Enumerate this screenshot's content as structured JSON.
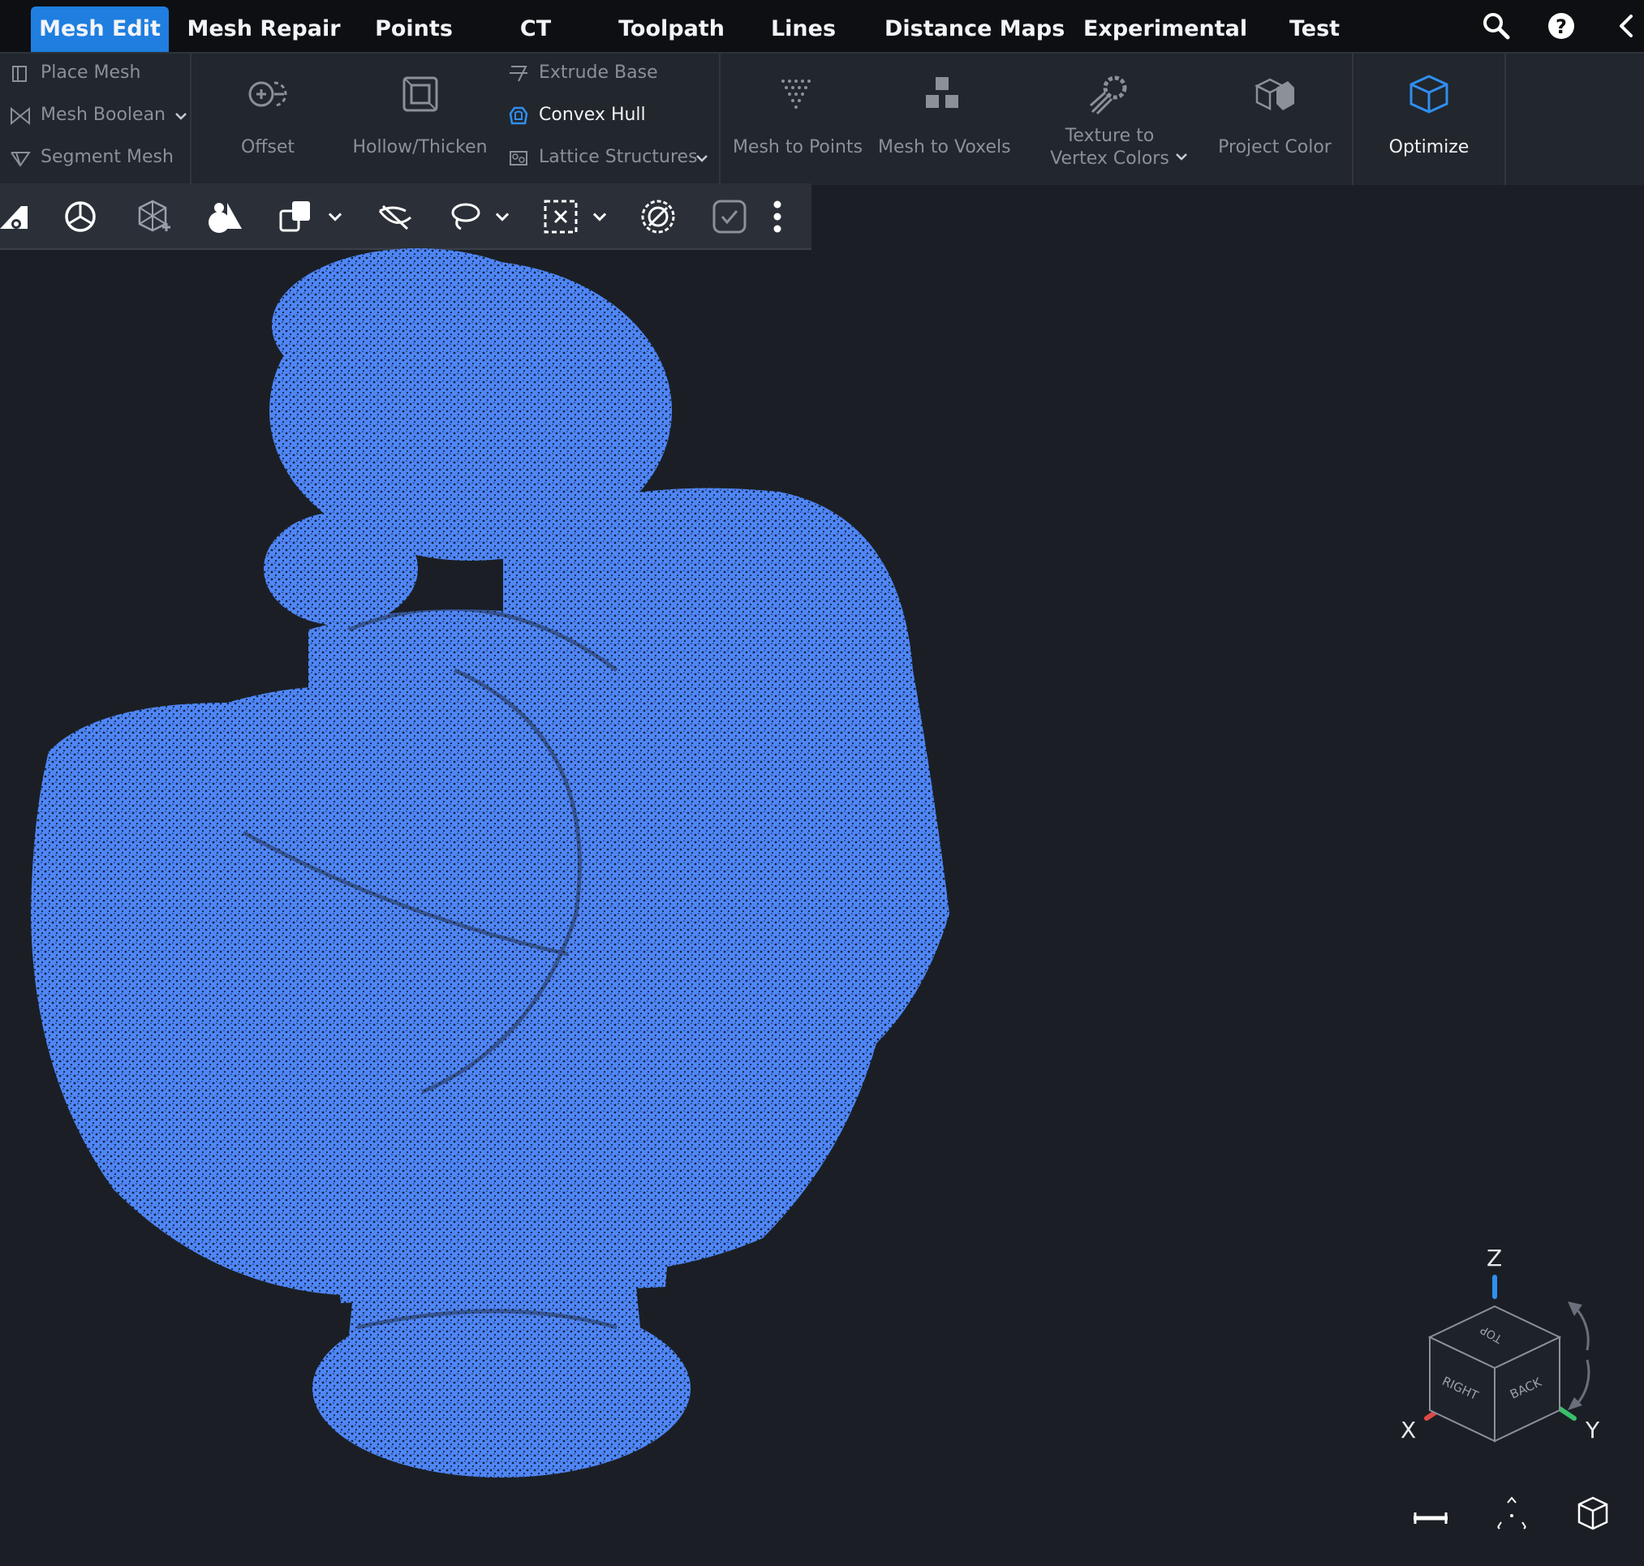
{
  "tabs": [
    {
      "label": "Mesh Edit",
      "active": true
    },
    {
      "label": "Mesh Repair"
    },
    {
      "label": "Points"
    },
    {
      "label": "CT"
    },
    {
      "label": "Toolpath"
    },
    {
      "label": "Lines"
    },
    {
      "label": "Distance Maps"
    },
    {
      "label": "Experimental"
    },
    {
      "label": "Test"
    }
  ],
  "top_icons": [
    "search-icon",
    "help-icon",
    "collapse-left-icon"
  ],
  "ribbon": {
    "left_group": [
      "Place Mesh",
      "Mesh Boolean",
      "Segment Mesh"
    ],
    "offset": "Offset",
    "hollow": "Hollow/Thicken",
    "right_small_group": [
      "Extrude Base",
      "Convex Hull",
      "Lattice Structures"
    ],
    "mesh_to_points": "Mesh to Points",
    "mesh_to_voxels": "Mesh to Voxels",
    "texture_line1": "Texture to",
    "texture_line2": "Vertex Colors",
    "project_color": "Project Color",
    "optimize": "Optimize"
  },
  "toolbar_icons": [
    "edit-settings-icon",
    "orbit-icon",
    "transform-icon",
    "shapes-icon",
    "copy-icon",
    "hide-icon",
    "lasso-icon",
    "box-select-icon",
    "deselect-icon",
    "check-icon",
    "more-icon"
  ],
  "nav_cube": {
    "z": "Z",
    "x": "X",
    "y": "Y",
    "top": "TOP",
    "right": "RIGHT",
    "back": "BACK"
  },
  "colors": {
    "accent": "#1f7ee0",
    "points": "#4f86f7",
    "axis_x": "#e04848",
    "axis_y": "#38c06a",
    "axis_z": "#2f8ff0"
  }
}
